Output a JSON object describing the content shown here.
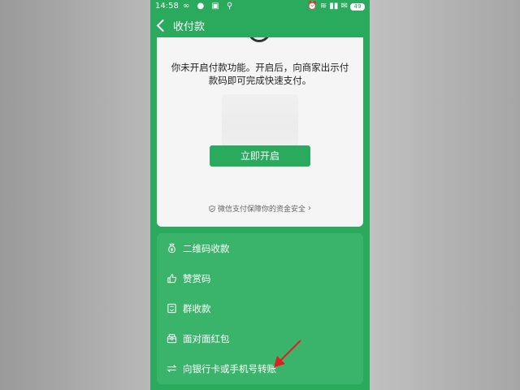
{
  "status_bar": {
    "time": "14:58",
    "left_icons": "∞ ● ▣ ⚲",
    "right_icons": "⏰ ≋ ▮▮ ✉",
    "battery": "49"
  },
  "nav": {
    "title": "收付款"
  },
  "card": {
    "description": "你未开启付款功能。开启后，向商家出示付款码即可完成快速支付。",
    "open_button": "立即开启",
    "security_note": "微信支付保障你的资金安全"
  },
  "menu": {
    "items": [
      {
        "label": "二维码收款",
        "icon": "money-bag-icon"
      },
      {
        "label": "赞赏码",
        "icon": "thumbs-up-icon"
      },
      {
        "label": "群收款",
        "icon": "group-receipt-icon"
      },
      {
        "label": "面对面红包",
        "icon": "red-packet-icon"
      },
      {
        "label": "向银行卡或手机号转账",
        "icon": "transfer-icon"
      }
    ]
  },
  "colors": {
    "brand_green": "#2aaa5c",
    "menu_green": "#3bb46b",
    "annotation_red": "#e02020"
  }
}
